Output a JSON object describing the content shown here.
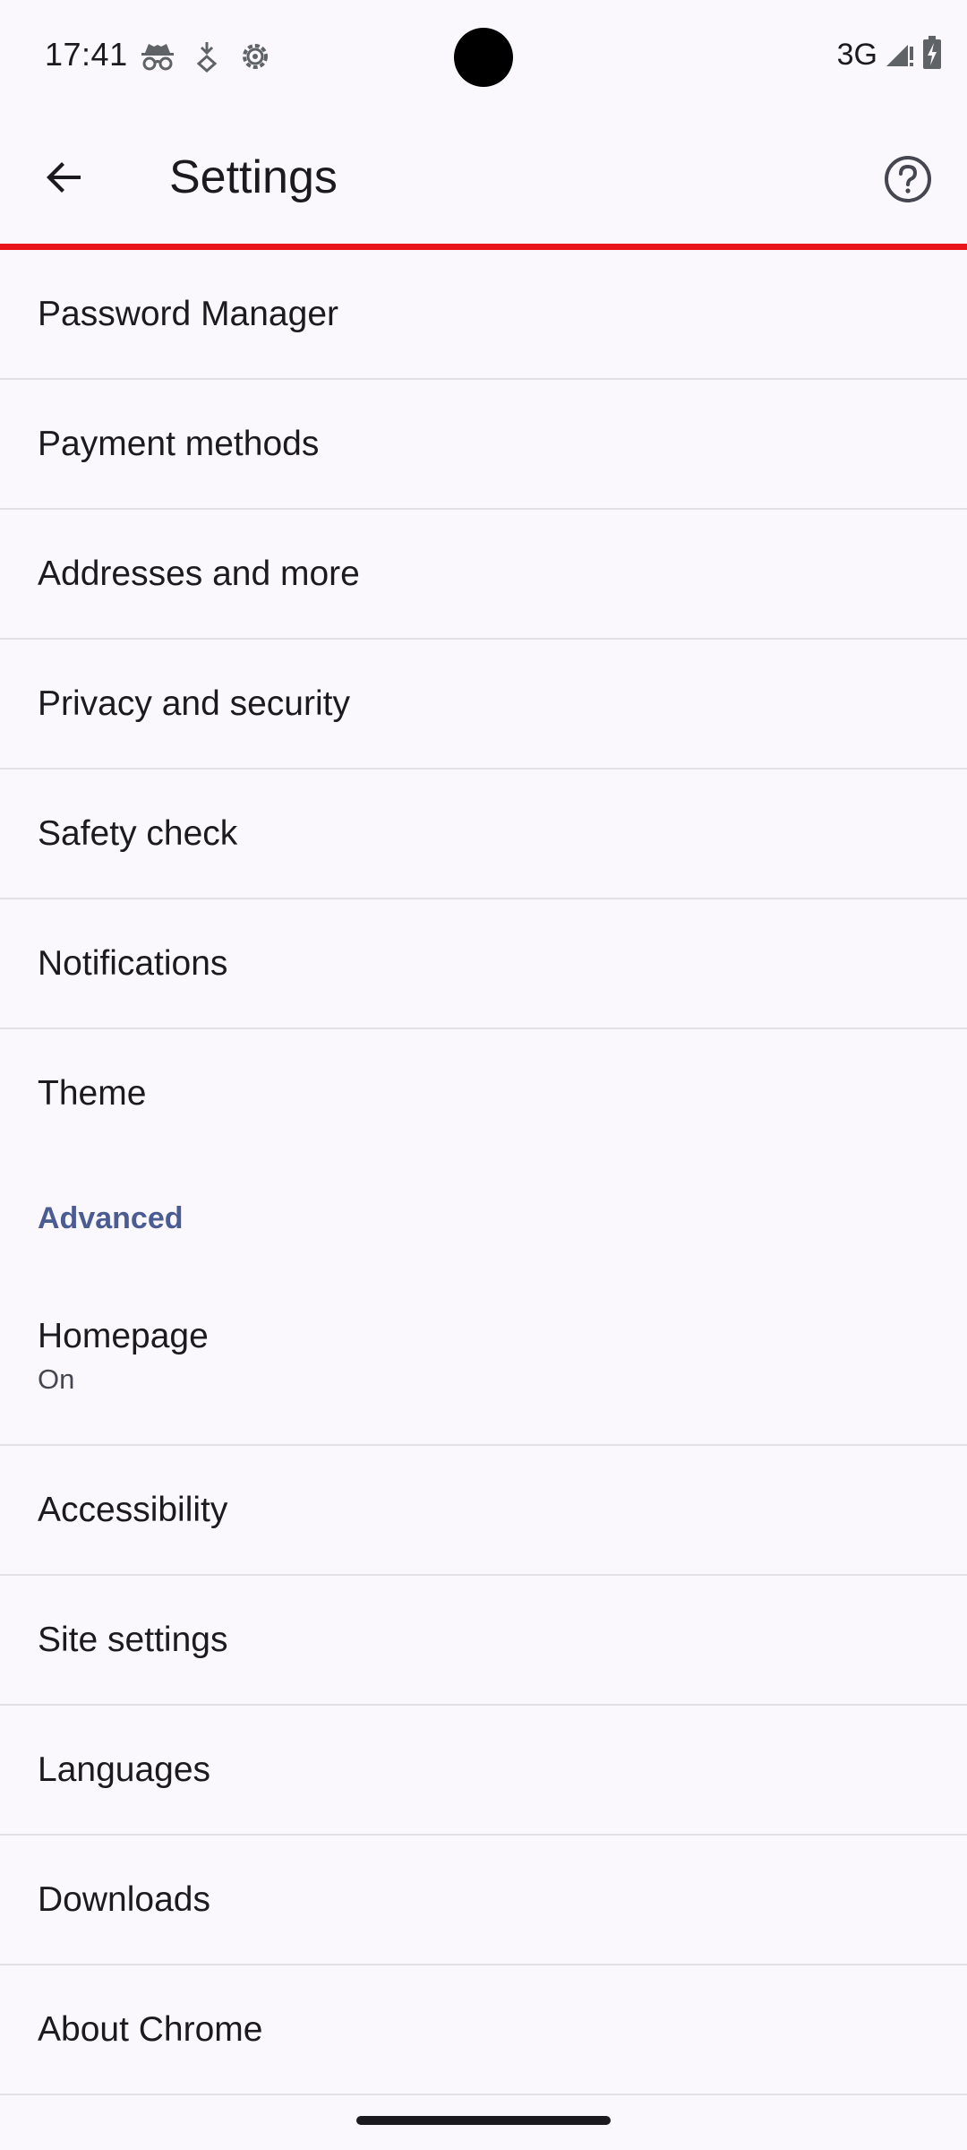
{
  "status_bar": {
    "time": "17:41",
    "left_icons": [
      "incognito-icon",
      "data-saver-icon",
      "settings-gear-icon"
    ],
    "network": "3G",
    "right_icons": [
      "signal-icon",
      "battery-charging-icon"
    ]
  },
  "app_bar": {
    "title": "Settings",
    "back_icon": "arrow-back-icon",
    "help_icon": "help-circle-icon"
  },
  "colors": {
    "accent": "#4b5c92",
    "progress": "#e8141a",
    "background": "#fbf8fd"
  },
  "list": {
    "basics": [
      {
        "label": "Password Manager"
      },
      {
        "label": "Payment methods"
      },
      {
        "label": "Addresses and more"
      },
      {
        "label": "Privacy and security"
      },
      {
        "label": "Safety check"
      },
      {
        "label": "Notifications"
      },
      {
        "label": "Theme"
      }
    ],
    "advanced_header": "Advanced",
    "homepage": {
      "label": "Homepage",
      "summary": "On"
    },
    "advanced": [
      {
        "label": "Accessibility"
      },
      {
        "label": "Site settings"
      },
      {
        "label": "Languages"
      },
      {
        "label": "Downloads"
      },
      {
        "label": "About Chrome"
      }
    ]
  }
}
